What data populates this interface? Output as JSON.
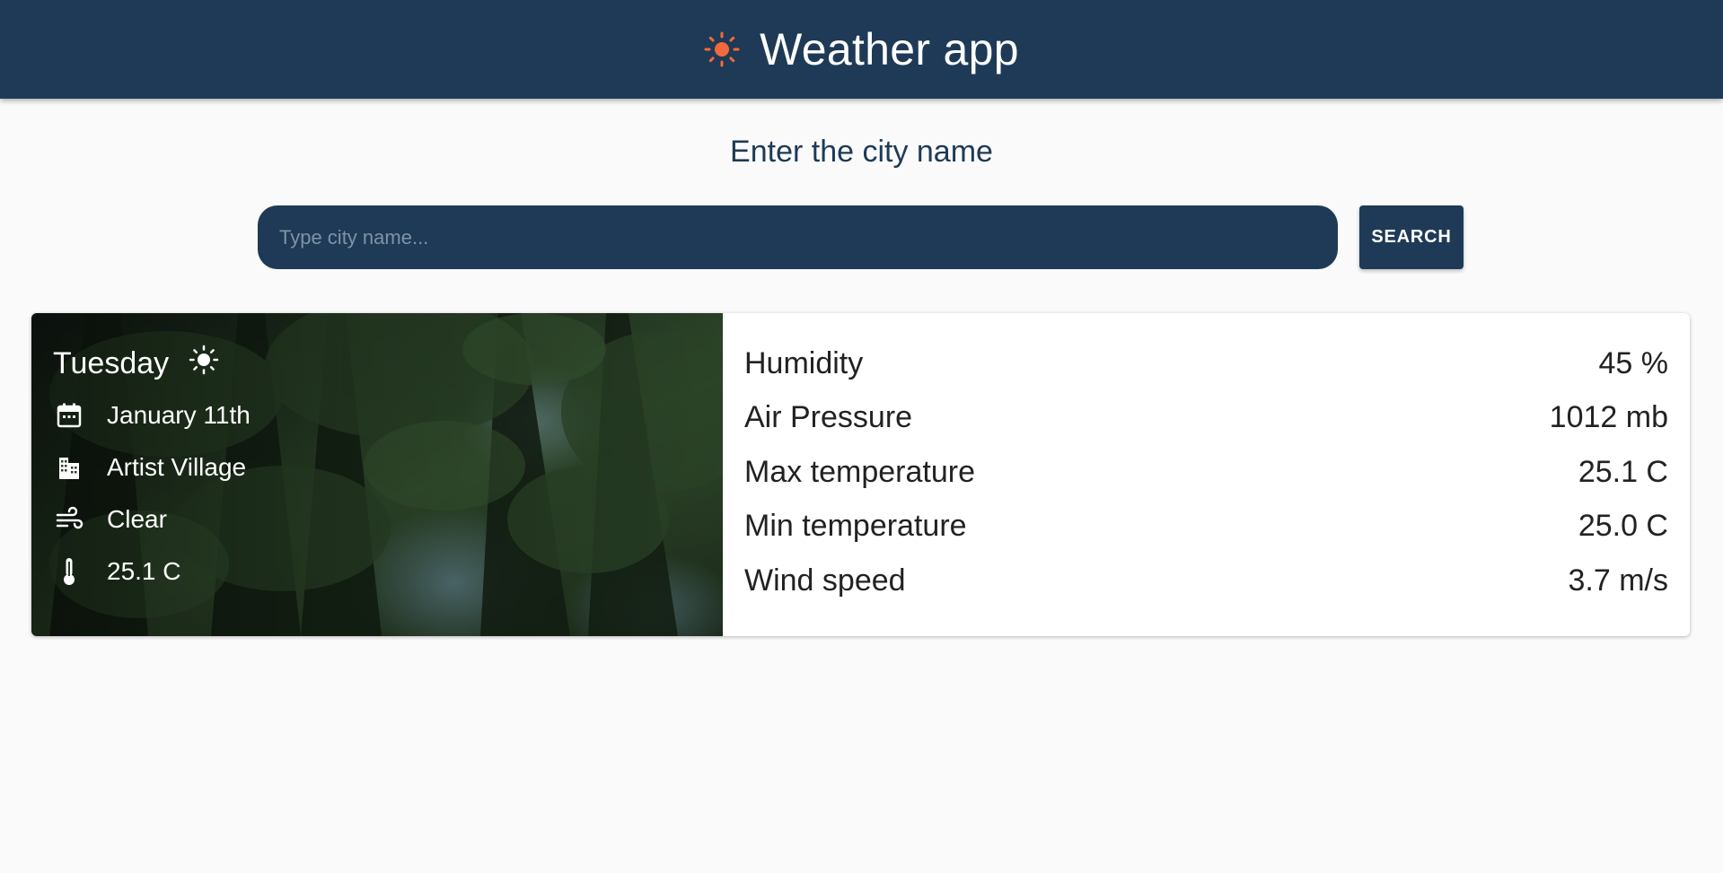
{
  "header": {
    "title": "Weather app",
    "logo_icon": "sun-icon",
    "background": "#1e3a56",
    "logo_color": "#f4693c"
  },
  "search": {
    "prompt": "Enter the city name",
    "placeholder": "Type city name...",
    "value": "",
    "button_label": "SEARCH"
  },
  "forecast": {
    "day": "Tuesday",
    "day_icon": "sun-icon",
    "date": "January 11th",
    "date_icon": "calendar-icon",
    "city": "Artist Village",
    "city_icon": "city-buildings-icon",
    "condition": "Clear",
    "condition_icon": "wind-icon",
    "temperature": "25.1 C",
    "temperature_icon": "thermometer-icon"
  },
  "stats": [
    {
      "label": "Humidity",
      "value": "45 %"
    },
    {
      "label": "Air Pressure",
      "value": "1012 mb"
    },
    {
      "label": "Max temperature",
      "value": "25.1 C"
    },
    {
      "label": "Min temperature",
      "value": "25.0 C"
    },
    {
      "label": "Wind speed",
      "value": "3.7 m/s"
    }
  ]
}
